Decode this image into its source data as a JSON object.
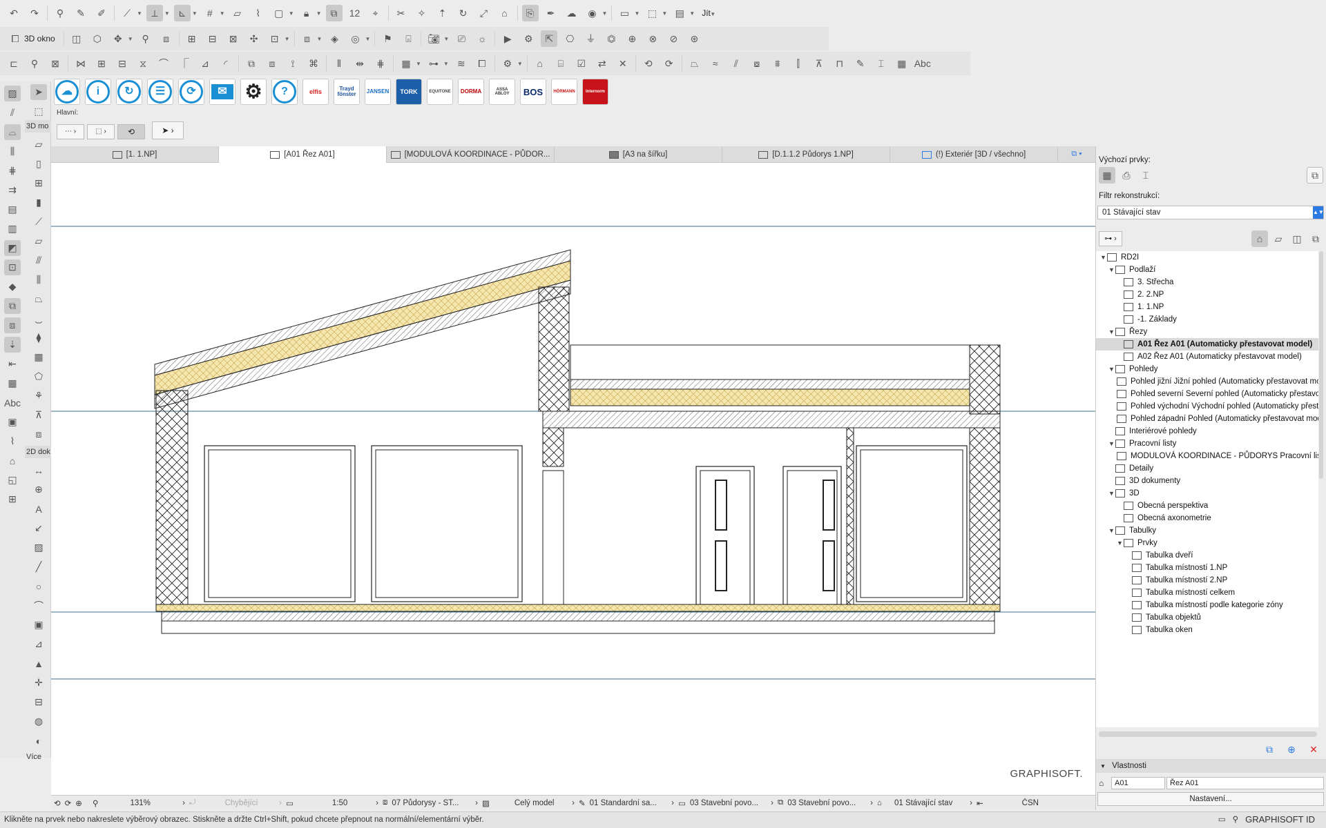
{
  "toolbar": {
    "view_label": "3D okno",
    "goto_label": "Jít",
    "info_label": "Hlavní:"
  },
  "brands": [
    "elfis",
    "Trayd fönster",
    "JANSEN",
    "TORK",
    "EQUITONE",
    "DORMA",
    "ASSA ABLOY",
    "BOS",
    "HÖRMANN",
    "Internorm"
  ],
  "left_toolbox": {
    "section_3d": "3D mo",
    "section_2d": "2D dok",
    "more": "Více"
  },
  "tabs": [
    {
      "label": "[1. 1.NP]"
    },
    {
      "label": "[A01 Řez A01]"
    },
    {
      "label": "[MODULOVÁ KOORDINACE - PŮDOR..."
    },
    {
      "label": "[A3 na šířku]"
    },
    {
      "label": "[D.1.1.2 Půdorys 1.NP]"
    },
    {
      "label": "(!) Exteriér [3D / všechno]"
    }
  ],
  "canvas": {
    "watermark": "GRAPHISOFT."
  },
  "right_panel": {
    "default_elements_label": "Výchozí prvky:",
    "reconstruction_filter_label": "Filtr rekonstrukcí:",
    "reconstruction_filter_value": "01 Stávající stav",
    "tree": [
      {
        "label": "RD2I",
        "level": 0,
        "expanded": true
      },
      {
        "label": "Podlaží",
        "level": 1,
        "expanded": true
      },
      {
        "label": "3. Střecha",
        "level": 2
      },
      {
        "label": "2. 2.NP",
        "level": 2
      },
      {
        "label": "1. 1.NP",
        "level": 2
      },
      {
        "label": "-1. Základy",
        "level": 2
      },
      {
        "label": "Řezy",
        "level": 1,
        "expanded": true
      },
      {
        "label": "A01 Řez A01 (Automaticky přestavovat model)",
        "level": 2,
        "selected": true
      },
      {
        "label": "A02 Řez A01 (Automaticky přestavovat model)",
        "level": 2
      },
      {
        "label": "Pohledy",
        "level": 1,
        "expanded": true
      },
      {
        "label": "Pohled jižní Jižní pohled (Automaticky přestavovat model)",
        "level": 2
      },
      {
        "label": "Pohled severní Severní pohled (Automaticky přestavovat model)",
        "level": 2
      },
      {
        "label": "Pohled východní Východní pohled (Automaticky přestavovat model)",
        "level": 2
      },
      {
        "label": "Pohled západní Pohled (Automaticky přestavovat model)",
        "level": 2
      },
      {
        "label": "Interiérové pohledy",
        "level": 1
      },
      {
        "label": "Pracovní listy",
        "level": 1,
        "expanded": true
      },
      {
        "label": "MODULOVÁ KOORDINACE - PŮDORYS Pracovní list",
        "level": 2
      },
      {
        "label": "Detaily",
        "level": 1
      },
      {
        "label": "3D dokumenty",
        "level": 1
      },
      {
        "label": "3D",
        "level": 1,
        "expanded": true
      },
      {
        "label": "Obecná perspektiva",
        "level": 2
      },
      {
        "label": "Obecná axonometrie",
        "level": 2
      },
      {
        "label": "Tabulky",
        "level": 1,
        "expanded": true
      },
      {
        "label": "Prvky",
        "level": 2,
        "expanded": true
      },
      {
        "label": "Tabulka dveří",
        "level": 3
      },
      {
        "label": "Tabulka místností 1.NP",
        "level": 3
      },
      {
        "label": "Tabulka místností 2.NP",
        "level": 3
      },
      {
        "label": "Tabulka místností celkem",
        "level": 3
      },
      {
        "label": "Tabulka místností podle kategorie zóny",
        "level": 3
      },
      {
        "label": "Tabulka objektů",
        "level": 3
      },
      {
        "label": "Tabulka oken",
        "level": 3
      }
    ],
    "properties_label": "Vlastnosti",
    "prop_id": "A01",
    "prop_name": "Řez A01",
    "settings_button": "Nastavení..."
  },
  "statusbar": {
    "zoom": "131%",
    "missing": "Chybějící",
    "scale": "1:50",
    "layer_combo": "07 Půdorysy - ST...",
    "model_view": "Celý model",
    "pen_set": "01 Standardní sa...",
    "mvo1": "03 Stavební povo...",
    "mvo2": "03 Stavební povo...",
    "renovation": "01 Stávající stav",
    "dimension": "ČSN"
  },
  "hint": "Klikněte na prvek nebo nakreslete výběrový obrazec. Stiskněte a držte Ctrl+Shift, pokud chcete přepnout na normální/elementární výběr.",
  "graphisoft_id": "GRAPHISOFT ID",
  "colors": {
    "accent": "#2a7ae2",
    "insulation": "#f5e6b0",
    "canvas": "#ffffff"
  }
}
